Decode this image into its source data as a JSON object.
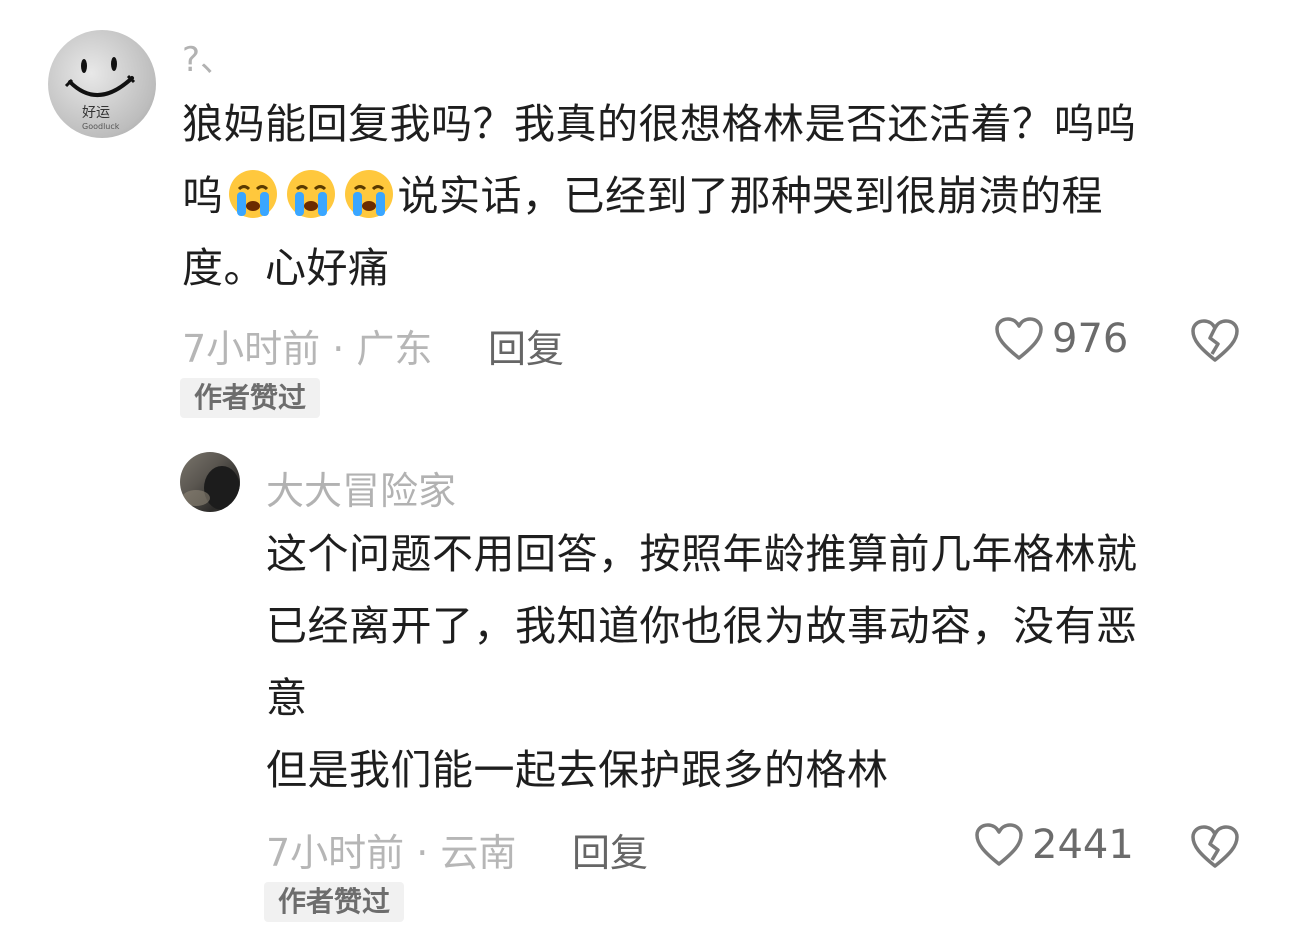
{
  "comments": [
    {
      "username": "?、",
      "avatar_text": "好运",
      "avatar_subtext": "Goodluck",
      "lines": [
        [
          "狼妈能回复我吗？我真的很想格林是否还活着？呜呜"
        ],
        [
          "呜",
          "😭",
          "😭",
          "😭",
          "说实话，已经到了那种哭到很崩溃的程"
        ],
        [
          "度。心好痛"
        ]
      ],
      "time_location": "7小时前 · 广东",
      "reply_label": "回复",
      "like_count": "976",
      "badge": "作者赞过"
    },
    {
      "username": "大大冒险家",
      "lines": [
        [
          "这个问题不用回答，按照年龄推算前几年格林就"
        ],
        [
          "已经离开了，我知道你也很为故事动容，没有恶"
        ],
        [
          "意"
        ],
        [
          "但是我们能一起去保护跟多的格林"
        ]
      ],
      "time_location": "7小时前 · 云南",
      "reply_label": "回复",
      "like_count": "2441",
      "badge": "作者赞过"
    }
  ],
  "icons": {
    "like": "heart-outline-icon",
    "dislike": "broken-heart-icon",
    "emoji": "loudly-crying-face"
  },
  "colors": {
    "text": "#1e1e1e",
    "muted": "#b6b6b6",
    "badge_bg": "#f1f1f1"
  }
}
